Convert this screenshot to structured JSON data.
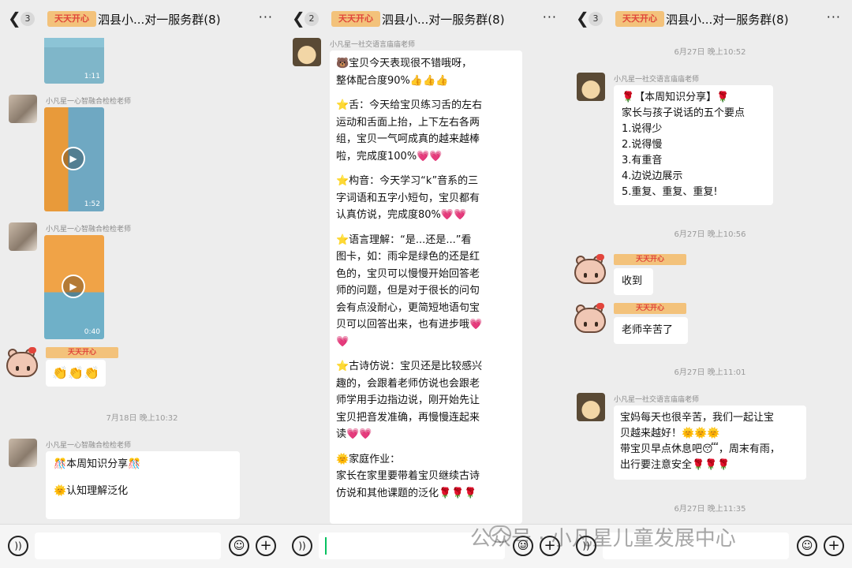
{
  "header": {
    "panels": [
      {
        "count": "3",
        "tag": "天天开心",
        "title": "泗县小...对一服务群(8)",
        "more": "···"
      },
      {
        "count": "2",
        "tag": "天天开心",
        "title": "泗县小...对一服务群(8)",
        "more": "···"
      },
      {
        "count": "3",
        "tag": "天天开心",
        "title": "泗县小...对一服务群(8)",
        "more": "···"
      }
    ]
  },
  "panel1": {
    "video1_duration": "1:11",
    "sender_a": "小凡星一心智融合检检老师",
    "video2_duration": "1:52",
    "sender_b": "小凡星一心智融合检检老师",
    "video3_duration": "0:40",
    "tag": "天天开心",
    "reaction": "👏👏👏",
    "time": "7月18日 晚上10:32",
    "sender_c": "小凡星一心智融合检检老师",
    "msg_lines": [
      "🎊本周知识分享🎊",
      "",
      "🌞认知理解泛化"
    ]
  },
  "panel2": {
    "sender": "小凡星一社交语言庙庙老师",
    "lines": [
      "🐻宝贝今天表现很不错哦呀，",
      "整体配合度90%👍👍👍",
      "",
      "⭐舌：今天给宝贝练习舌的左右",
      "运动和舌面上抬，上下左右各两",
      "组，宝贝一气呵成真的越来越棒",
      "啦，完成度100%💗💗",
      "",
      "⭐构音：今天学习“k”音系的三",
      "字词语和五字小短句，宝贝都有",
      "认真仿说，完成度80%💗💗",
      "",
      "⭐语言理解：“是...还是...”看",
      "图卡，如：雨伞是绿色的还是红",
      "色的，宝贝可以慢慢开始回答老",
      "师的问题，但是对于很长的问句",
      "会有点没耐心，更简短地语句宝",
      "贝可以回答出来，也有进步哦💗",
      "💗",
      "",
      "⭐古诗仿说：宝贝还是比较感兴",
      "趣的，会跟着老师仿说也会跟老",
      "师学用手边指边说，刚开始先让",
      "宝贝把音发准确，再慢慢连起来",
      "读💗💗",
      "",
      "🌞家庭作业：",
      "家长在家里要带着宝贝继续古诗",
      "仿说和其他课题的泛化🌹🌹🌹"
    ]
  },
  "panel3": {
    "time1": "6月27日 晚上10:52",
    "sender1": "小凡星一社交语言庙庙老师",
    "msg1_lines": [
      "🌹【本周知识分享】🌹",
      "家长与孩子说话的五个要点",
      "1.说得少",
      "2.说得慢",
      "3.有重音",
      "4.边说边展示",
      "5.重复、重复、重复!"
    ],
    "time2": "6月27日 晚上10:56",
    "tag_a": "天天开心",
    "reply1": "收到",
    "tag_b": "天天开心",
    "reply2": "老师辛苦了",
    "time3": "6月27日 晚上11:01",
    "sender2": "小凡星一社交语言庙庙老师",
    "msg2_lines": [
      "宝妈每天也很辛苦，我们一起让宝",
      "贝越来越好！🌞🌞🌞",
      "带宝贝早点休息吧😴，周末有雨，",
      "出行要注意安全🌹🌹🌹"
    ],
    "time4": "6月27日 晚上11:35"
  },
  "bottombar": {
    "voice_icon": "))",
    "emoji_icon": "☺",
    "plus_icon": "+"
  },
  "watermark": "公众号 · 小凡星儿童发展中心"
}
